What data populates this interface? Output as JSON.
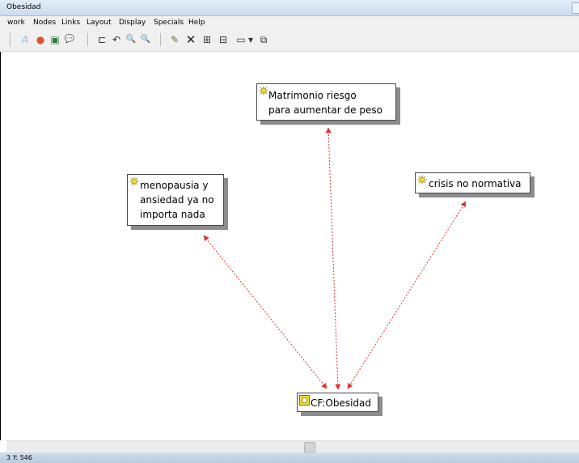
{
  "window": {
    "title": "Obesidad"
  },
  "menu": [
    "work",
    "Nodes",
    "Links",
    "Layout",
    "Display",
    "Specials",
    "Help"
  ],
  "toolbar": [
    {
      "name": "text-tool-icon",
      "glyph": "A",
      "color": "#9fb3d6"
    },
    {
      "name": "color-wheel-icon",
      "glyph": "●",
      "color": "#e0522a"
    },
    {
      "name": "frame-icon",
      "glyph": "▣",
      "color": "#2d7a3a"
    },
    {
      "name": "comment-icon",
      "glyph": "💬",
      "color": "#555"
    },
    {
      "name": "hierarchy-icon",
      "glyph": "⊏",
      "color": "#333"
    },
    {
      "name": "undo-icon",
      "glyph": "↶",
      "color": "#333"
    },
    {
      "name": "zoom-out-icon",
      "glyph": "🔍",
      "color": "#333"
    },
    {
      "name": "zoom-in-icon",
      "glyph": "🔍",
      "color": "#333"
    },
    {
      "name": "new-node-icon",
      "glyph": "✎",
      "color": "#7a6a1e"
    },
    {
      "name": "delete-icon",
      "glyph": "✕",
      "color": "#222"
    },
    {
      "name": "layout-tree-icon",
      "glyph": "⊞",
      "color": "#333"
    },
    {
      "name": "layout-alt-icon",
      "glyph": "⊟",
      "color": "#333"
    },
    {
      "name": "display-mode-icon",
      "glyph": "▭",
      "color": "#333"
    },
    {
      "name": "dropdown-icon",
      "glyph": "▾",
      "color": "#333"
    },
    {
      "name": "copy-view-icon",
      "glyph": "⧉",
      "color": "#333"
    }
  ],
  "nodes": {
    "matrimonio": "Matrimonio riesgo\npara aumentar de peso",
    "menopausia": "menopausia y\nansiedad ya no\nimporta nada",
    "crisis": "crisis no normativa",
    "obesidad": "CF:Obesidad"
  },
  "link_color": "#e03030",
  "status": {
    "coords": "3 Y: 546"
  }
}
